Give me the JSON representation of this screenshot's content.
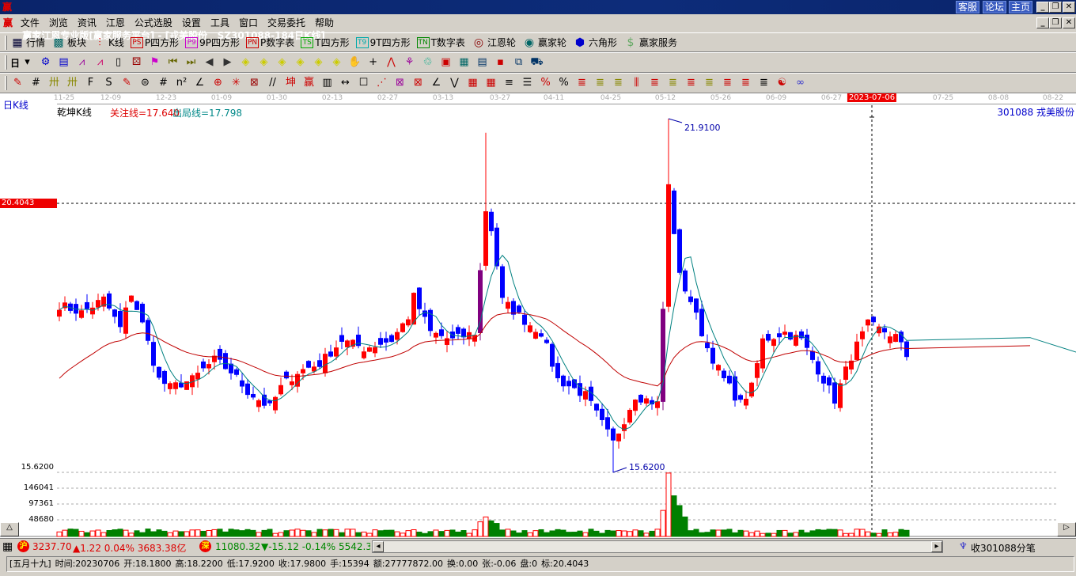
{
  "titlebar": {
    "app": "赢家江恩专业版[赢家服务平台] - [戎美股份   SZ301088-184日K线]",
    "logo": "赢",
    "buttons": [
      "客服",
      "论坛",
      "主页"
    ]
  },
  "menu": {
    "logo": "赢",
    "items": [
      "文件",
      "浏览",
      "资讯",
      "江恩",
      "公式选股",
      "设置",
      "工具",
      "窗口",
      "交易委托",
      "帮助"
    ]
  },
  "toolbar1": [
    {
      "icon": "quote-table-icon",
      "glyph": "▦",
      "label": "行情",
      "color": "#003"
    },
    {
      "icon": "sector-grid-icon",
      "glyph": "▩",
      "label": "板块",
      "color": "#066"
    },
    {
      "icon": "kline-icon",
      "glyph": "⫶",
      "label": "K线",
      "color": "#d00"
    },
    {
      "icon": "ps-icon",
      "glyph": "PS",
      "label": "P四方形",
      "color": "#c00"
    },
    {
      "icon": "p9-icon",
      "glyph": "P9",
      "label": "9P四方形",
      "color": "#c0c"
    },
    {
      "icon": "pn-icon",
      "glyph": "PN",
      "label": "P数字表",
      "color": "#c00"
    },
    {
      "icon": "ts-icon",
      "glyph": "TS",
      "label": "T四方形",
      "color": "#0a0"
    },
    {
      "icon": "t9-icon",
      "glyph": "T9",
      "label": "9T四方形",
      "color": "#0aa"
    },
    {
      "icon": "tn-icon",
      "glyph": "TN",
      "label": "T数字表",
      "color": "#080"
    },
    {
      "icon": "gann-wheel-icon",
      "glyph": "◎",
      "label": "江恩轮",
      "color": "#800"
    },
    {
      "icon": "winner-wheel-icon",
      "glyph": "◉",
      "label": "赢家轮",
      "color": "#066"
    },
    {
      "icon": "hexagon-icon",
      "glyph": "⬢",
      "label": "六角形",
      "color": "#00c"
    },
    {
      "icon": "dollar-icon",
      "glyph": "$",
      "label": "赢家服务",
      "color": "#6a6"
    }
  ],
  "toolbar2": {
    "period": "日",
    "icons": [
      [
        "period-dropdown-icon",
        "▾",
        "#000"
      ],
      [
        "chain-icon",
        "⚙",
        "#00c"
      ],
      [
        "clipboard-icon",
        "▤",
        "#00c"
      ],
      [
        "indicator3-icon",
        "⩘",
        "#909"
      ],
      [
        "indicator9-icon",
        "⩘",
        "#c06"
      ],
      [
        "candle-type-icon",
        "▯",
        "#000"
      ],
      [
        "pattern-icon",
        "⚄",
        "#900"
      ],
      [
        "flag-icon",
        "⚑",
        "#c0c"
      ],
      [
        "first-icon",
        "⏮",
        "#660"
      ],
      [
        "last-icon",
        "⏭",
        "#660"
      ],
      [
        "prev-icon",
        "◀",
        "#333"
      ],
      [
        "next-icon",
        "▶",
        "#333"
      ],
      [
        "left-arrow-icon",
        "◈",
        "#cc0"
      ],
      [
        "right-arrow-icon",
        "◈",
        "#cc0"
      ],
      [
        "expand-h-icon",
        "◈",
        "#cc0"
      ],
      [
        "zoom-in-icon",
        "◈",
        "#cc0"
      ],
      [
        "zoom-out-icon",
        "◈",
        "#cc0"
      ],
      [
        "expand-v-icon",
        "◈",
        "#cc0"
      ],
      [
        "hand-icon",
        "✋",
        "#333"
      ],
      [
        "crosshair-icon",
        "+",
        "#000"
      ],
      [
        "trend-icon",
        "⋀",
        "#c00"
      ],
      [
        "brain-icon",
        "⚘",
        "#909"
      ],
      [
        "recycle-icon",
        "♲",
        "#0a8"
      ],
      [
        "calendar-icon",
        "▣",
        "#c00"
      ],
      [
        "calculator-icon",
        "▦",
        "#066"
      ],
      [
        "notes-icon",
        "▤",
        "#036"
      ],
      [
        "save-icon",
        "▪",
        "#c00"
      ],
      [
        "network-icon",
        "⧉",
        "#036"
      ],
      [
        "truck-icon",
        "⛟",
        "#036"
      ]
    ]
  },
  "toolbar3": {
    "icons": [
      [
        "pen-icon",
        "✎",
        "#c00"
      ],
      [
        "parallel-icon",
        "#",
        "#000"
      ],
      [
        "gold-line-icon",
        "卅",
        "#880"
      ],
      [
        "gold-line2-icon",
        "卅",
        "#880"
      ],
      [
        "fib-icon",
        "F",
        "#000"
      ],
      [
        "spiral-icon",
        "S",
        "#000"
      ],
      [
        "pen2-icon",
        "✎",
        "#c00"
      ],
      [
        "circle-grid-icon",
        "⊜",
        "#000"
      ],
      [
        "grid-lines-icon",
        "#",
        "#000"
      ],
      [
        "n2-icon",
        "n²",
        "#000"
      ],
      [
        "angle-icon",
        "∠",
        "#000"
      ],
      [
        "target-icon",
        "⊕",
        "#c00"
      ],
      [
        "star-icon",
        "✳",
        "#c00"
      ],
      [
        "square-web-icon",
        "⊠",
        "#900"
      ],
      [
        "slash-icon",
        "//",
        "#000"
      ],
      [
        "kun-icon",
        "坤",
        "#c00"
      ],
      [
        "ying-icon",
        "赢",
        "#c00"
      ],
      [
        "ruler-icon",
        "▥",
        "#000"
      ],
      [
        "width-icon",
        "↔",
        "#000"
      ],
      [
        "box-icon",
        "☐",
        "#000"
      ],
      [
        "fan-icon",
        "⋰",
        "#c00"
      ],
      [
        "box-fan-icon",
        "⊠",
        "#909"
      ],
      [
        "fan-box2-icon",
        "⊠",
        "#c00"
      ],
      [
        "gann-angle-icon",
        "∠",
        "#000"
      ],
      [
        "zigzag-icon",
        "⋁",
        "#000"
      ],
      [
        "grid-red-icon",
        "▦",
        "#c00"
      ],
      [
        "grid-red2-icon",
        "▦",
        "#c00"
      ],
      [
        "multi-line-icon",
        "≡",
        "#000"
      ],
      [
        "table-icon",
        "☰",
        "#000"
      ],
      [
        "percent-line-icon",
        "%",
        "#c00"
      ],
      [
        "percent-icon",
        "%",
        "#000"
      ],
      [
        "level-icon",
        "≣",
        "#c00"
      ],
      [
        "gold-level-icon",
        "≣",
        "#880"
      ],
      [
        "gold2-icon",
        "≣",
        "#880"
      ],
      [
        "bars-icon",
        "⫼",
        "#c00"
      ],
      [
        "gold3-icon",
        "≣",
        "#c00"
      ],
      [
        "gold4-icon",
        "≣",
        "#880"
      ],
      [
        "gold5-icon",
        "≣",
        "#c00"
      ],
      [
        "gold6-icon",
        "≣",
        "#880"
      ],
      [
        "gold7-icon",
        "≣",
        "#c00"
      ],
      [
        "gold8-icon",
        "≣",
        "#c00"
      ],
      [
        "gold9-icon",
        "≣",
        "#000"
      ],
      [
        "yin-yang-icon",
        "☯",
        "#c00"
      ],
      [
        "infinity-icon",
        "∞",
        "#33c"
      ]
    ]
  },
  "chart": {
    "period_label": "日K线",
    "indicator_name": "乾坤K线",
    "focus_line": "关注线=17.640",
    "exit_line": "出局线=17.798",
    "stock_label": "301088  戎美股份",
    "cursor_date": "2023-07-06",
    "price_marker": "20.4043",
    "dates": [
      "11-25",
      "12-09",
      "12-23",
      "01-09",
      "01-30",
      "02-13",
      "02-27",
      "03-13",
      "03-27",
      "04-11",
      "04-25",
      "05-12",
      "05-26",
      "06-09",
      "06-27",
      "07-25",
      "08-08",
      "08-22"
    ],
    "high_label": "21.9100",
    "low_label": "15.6200",
    "volume_axis": [
      "15.6200",
      "146041",
      "97361",
      "48680"
    ],
    "colors": {
      "up": "#ff0000",
      "down": "#0000ff",
      "strong": "#800080",
      "fast_ma": "#008080",
      "slow_ma": "#c00000",
      "vol_up": "#ff0000",
      "vol_down": "#008000"
    }
  },
  "chart_data": {
    "type": "candlestick",
    "bars": 154,
    "close_keypoints": [
      [
        0,
        18.6
      ],
      [
        4,
        18.46
      ],
      [
        8,
        18.7
      ],
      [
        11,
        18.18
      ],
      [
        13,
        18.81
      ],
      [
        15,
        18.25
      ],
      [
        18,
        17.27
      ],
      [
        20,
        17.13
      ],
      [
        24,
        17.27
      ],
      [
        28,
        17.62
      ],
      [
        31,
        17.41
      ],
      [
        34,
        17.06
      ],
      [
        38,
        16.77
      ],
      [
        40,
        17.13
      ],
      [
        43,
        17.41
      ],
      [
        47,
        17.55
      ],
      [
        51,
        17.97
      ],
      [
        55,
        17.83
      ],
      [
        60,
        17.97
      ],
      [
        63,
        18.39
      ],
      [
        64,
        18.74
      ],
      [
        67,
        18.11
      ],
      [
        71,
        17.97
      ],
      [
        75,
        18.11
      ],
      [
        77,
        20.29
      ],
      [
        78,
        19.94
      ],
      [
        80,
        18.67
      ],
      [
        84,
        18.32
      ],
      [
        87,
        18.11
      ],
      [
        90,
        17.27
      ],
      [
        95,
        16.99
      ],
      [
        100,
        16.14
      ],
      [
        101,
        16.35
      ],
      [
        104,
        16.99
      ],
      [
        108,
        16.84
      ],
      [
        109,
        18.53
      ],
      [
        110,
        20.71
      ],
      [
        112,
        19.1
      ],
      [
        114,
        18.67
      ],
      [
        117,
        17.83
      ],
      [
        120,
        17.27
      ],
      [
        123,
        16.84
      ],
      [
        125,
        17.13
      ],
      [
        127,
        17.97
      ],
      [
        131,
        18.11
      ],
      [
        134,
        17.97
      ],
      [
        138,
        17.27
      ],
      [
        140,
        16.91
      ],
      [
        143,
        17.69
      ],
      [
        146,
        18.25
      ],
      [
        151,
        18.04
      ],
      [
        153,
        17.69
      ]
    ],
    "high_extreme": {
      "bar": 110,
      "value": 21.91
    },
    "high_wick": {
      "bar": 77,
      "value": 21.66
    },
    "low_extreme": {
      "bar": 100,
      "value": 15.62
    },
    "price_axis": [
      15.62,
      20.4043
    ],
    "volume_spikes": [
      [
        76,
        45000
      ],
      [
        77,
        60000
      ],
      [
        78,
        48000
      ],
      [
        79,
        40000
      ],
      [
        109,
        80000
      ],
      [
        110,
        195000
      ],
      [
        111,
        125000
      ],
      [
        112,
        95000
      ],
      [
        113,
        60000
      ]
    ],
    "last_bar": {
      "lunar": "[五月十九]",
      "time": "时间:20230706",
      "open": "开:18.1800",
      "high": "高:18.2200",
      "low": "低:17.9200",
      "close": "收:17.9800",
      "volume": "手:15394",
      "amount": "额:27777872.00",
      "turnover": "换:0.00",
      "change": "张:-0.06",
      "plate": "盘:0",
      "mark": "标:20.4043"
    }
  },
  "status": {
    "sh": {
      "badge": "沪",
      "index": "3237.70",
      "change": "▲1.22 0.04% 3683.38亿"
    },
    "sz": {
      "badge": "深",
      "index": "11080.32",
      "change": "▼-15.12 -0.14% 5542.3"
    },
    "receive": "收301088分笔"
  },
  "controls": {
    "scroll_up": "△",
    "scroll_right": "▷",
    "left_arrow": "◂",
    "right_arrow": "▸"
  }
}
